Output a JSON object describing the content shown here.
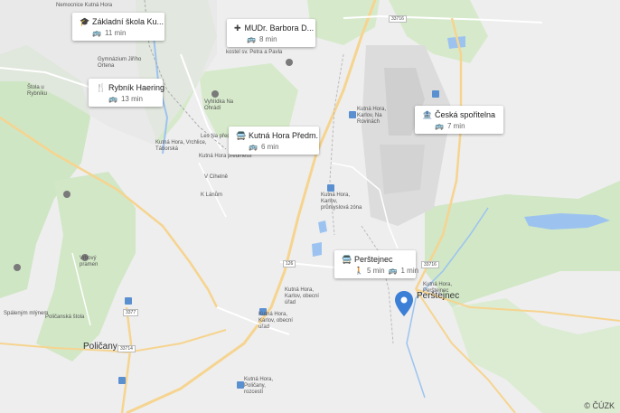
{
  "cards": [
    {
      "id": "card-skola",
      "icon": "school-icon",
      "title": "Základní škola Ku...",
      "time": "11 min"
    },
    {
      "id": "card-mudr",
      "icon": "medical-icon",
      "title": "MUDr. Barbora D...",
      "time": "8 min"
    },
    {
      "id": "card-rybnik",
      "icon": "restaurant-icon",
      "title": "Rybník Haering",
      "time": "13 min"
    },
    {
      "id": "card-kutna",
      "icon": "bus-stop-icon",
      "title": "Kutná Hora Předm.",
      "time": "6 min"
    },
    {
      "id": "card-sporitelna",
      "icon": "bank-icon",
      "title": "Česká spořitelna",
      "time": "7 min"
    },
    {
      "id": "card-perstejnec",
      "icon": "bus-stop-icon",
      "title": "Perštejnec",
      "walk_time": "5 min",
      "bus_time": "1 min"
    }
  ],
  "towns": {
    "perstejnec": "Perštejnec",
    "policany": "Poličany"
  },
  "road_badges": {
    "r33716a": "33716",
    "r126": "126",
    "r33716b": "33716",
    "r3377": "3377",
    "r33714": "33714"
  },
  "small_labels": {
    "nemocnice": "Nemocnice Kutná Hora",
    "kutna_vrchlice": "Kutná Hora, Vrchlice, Táborská",
    "kutna_karlov_prumysl": "Kutná Hora, Karlov, průmyslová zóna",
    "kutna_karlov_obec": "Kutná Hora, Karlov, obecní úřad",
    "kutna_policany": "Kutná Hora, Poličany, rozcestí",
    "kutna_predm": "Kutná Hora předměstí",
    "les_na_predm": "Les Na předm.",
    "vyhlidka": "Vyhlídka Na Ohrádí",
    "kostel": "kostel sv. Petra a Pavla",
    "gymnazium": "Gymnázium Jiřího Ortena",
    "k_lanum": "K Lánům",
    "perstejnec_stop": "Kutná Hora, Perštejnec",
    "v_cihelne": "V Cihelně",
    "na_rovinach": "Kutná Hora, Karlov, Na Rovinách",
    "spalenym_mlynem": "Spáleným mlýnem",
    "policanska_stola": "Poličanská štola",
    "vrbovy_pramen": "Vrbový pramen",
    "stula_u_rybniku": "Štola u Rybníku"
  },
  "attribution": "© ČÚZK"
}
